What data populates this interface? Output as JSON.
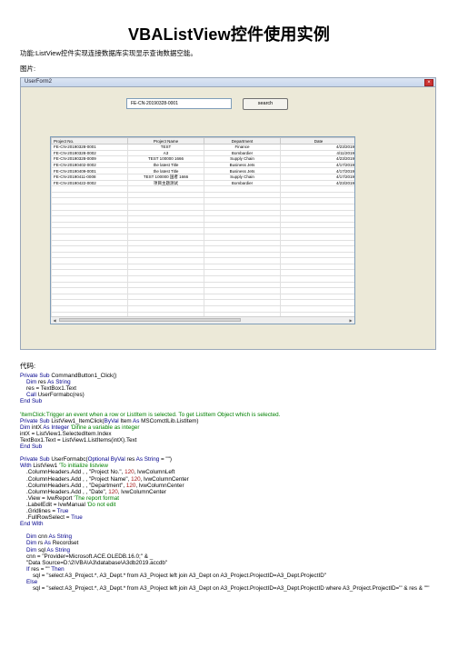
{
  "page": {
    "title": "VBAListView控件使用实例",
    "intro": "功能:ListView控件实现连接数据库实现显示查询数据空能。",
    "image_label": "图片:",
    "code_label": "代码:"
  },
  "form": {
    "title": "UserForm2",
    "textbox_value": "FE-CN-20190328-0001",
    "search_label": "search",
    "columns": [
      "Project No.",
      "Project Name",
      "Department",
      "Date"
    ],
    "rows": [
      [
        "FE-CN-20190328-0001",
        "TEST",
        "Finance",
        "4/23/2019"
      ],
      [
        "FE-CN-20190328-0002",
        "A3",
        "Bombardier",
        "4/11/2019"
      ],
      [
        "FE-CN-20190328-0009",
        "TEST 100000 1666",
        "Supply Chain",
        "4/23/2019"
      ],
      [
        "FE-CN-20190402-0002",
        "the latest Title",
        "Business Jets",
        "4/17/2019"
      ],
      [
        "FE-CN-20190409-0001",
        "the latest Title",
        "Business Jets",
        "4/17/2019"
      ],
      [
        "FE-CN-20190411-0008",
        "TEST 100000 国者 1666",
        "Supply Chain",
        "4/17/2019"
      ],
      [
        "FE-CN-20190422-0002",
        "项目主题测试",
        "Bombardier",
        "4/23/2019"
      ]
    ]
  },
  "code": [
    [
      {
        "t": "Private Sub ",
        "c": "kw"
      },
      {
        "t": "CommandButton1_Click()",
        "c": ""
      }
    ],
    [
      {
        "t": "    Dim ",
        "c": "kw"
      },
      {
        "t": "res ",
        "c": ""
      },
      {
        "t": "As String",
        "c": "kw"
      }
    ],
    [
      {
        "t": "    res = TextBox1.Text",
        "c": ""
      }
    ],
    [
      {
        "t": "    Call ",
        "c": "kw"
      },
      {
        "t": "UserFormabc(res)",
        "c": ""
      }
    ],
    [
      {
        "t": "End Sub",
        "c": "kw"
      }
    ],
    [
      {
        "t": "",
        "c": ""
      }
    ],
    [
      {
        "t": "'ItemClick:Trigger an event when a row or ListItem is selected. To get ListItem Object which is selected.",
        "c": "cm"
      }
    ],
    [
      {
        "t": "Private Sub ",
        "c": "kw"
      },
      {
        "t": "ListView1_ItemClick(",
        "c": ""
      },
      {
        "t": "ByVal ",
        "c": "kw"
      },
      {
        "t": "Item ",
        "c": ""
      },
      {
        "t": "As ",
        "c": "kw"
      },
      {
        "t": "MSComctlLib.ListItem)",
        "c": ""
      }
    ],
    [
      {
        "t": "Dim ",
        "c": "kw"
      },
      {
        "t": "intX ",
        "c": ""
      },
      {
        "t": "As Integer ",
        "c": "kw"
      },
      {
        "t": "'Difine a variable as integer",
        "c": "cm"
      }
    ],
    [
      {
        "t": "intX = ListView1.SelectedItem.Index",
        "c": ""
      }
    ],
    [
      {
        "t": "TextBox1.Text = ListView1.ListItems(intX).Text",
        "c": ""
      }
    ],
    [
      {
        "t": "End Sub",
        "c": "kw"
      }
    ],
    [
      {
        "t": "",
        "c": ""
      }
    ],
    [
      {
        "t": "Private Sub ",
        "c": "kw"
      },
      {
        "t": "UserFormabc(",
        "c": ""
      },
      {
        "t": "Optional ByVal ",
        "c": "kw"
      },
      {
        "t": "res ",
        "c": ""
      },
      {
        "t": "As String ",
        "c": "kw"
      },
      {
        "t": "= \"\")",
        "c": ""
      }
    ],
    [
      {
        "t": "With ",
        "c": "kw"
      },
      {
        "t": "ListView1 ",
        "c": ""
      },
      {
        "t": "'To initialize listview",
        "c": "cm"
      }
    ],
    [
      {
        "t": "    .ColumnHeaders.Add , , \"Project No.\", ",
        "c": ""
      },
      {
        "t": "120",
        "c": "nm"
      },
      {
        "t": ", lvwColumnLeft",
        "c": ""
      }
    ],
    [
      {
        "t": "    .ColumnHeaders.Add , , \"Project Name\", ",
        "c": ""
      },
      {
        "t": "120",
        "c": "nm"
      },
      {
        "t": ", lvwColumnCenter",
        "c": ""
      }
    ],
    [
      {
        "t": "    .ColumnHeaders.Add , , \"Department\", ",
        "c": ""
      },
      {
        "t": "120",
        "c": "nm"
      },
      {
        "t": ", lvwColumnCenter",
        "c": ""
      }
    ],
    [
      {
        "t": "    .ColumnHeaders.Add , , \"Date\", ",
        "c": ""
      },
      {
        "t": "120",
        "c": "nm"
      },
      {
        "t": ", lvwColumnCenter",
        "c": ""
      }
    ],
    [
      {
        "t": "    .View = lvwReport ",
        "c": ""
      },
      {
        "t": "'The report format",
        "c": "cm"
      }
    ],
    [
      {
        "t": "    .LabelEdit = lvwManual ",
        "c": ""
      },
      {
        "t": "'Do not edit",
        "c": "cm"
      }
    ],
    [
      {
        "t": "    .Gridlines = ",
        "c": ""
      },
      {
        "t": "True",
        "c": "kw"
      }
    ],
    [
      {
        "t": "    .FullRowSelect = ",
        "c": ""
      },
      {
        "t": "True",
        "c": "kw"
      }
    ],
    [
      {
        "t": "End With",
        "c": "kw"
      }
    ],
    [
      {
        "t": "",
        "c": ""
      }
    ],
    [
      {
        "t": "    Dim ",
        "c": "kw"
      },
      {
        "t": "cnn ",
        "c": ""
      },
      {
        "t": "As String",
        "c": "kw"
      }
    ],
    [
      {
        "t": "    Dim ",
        "c": "kw"
      },
      {
        "t": "rs ",
        "c": ""
      },
      {
        "t": "As ",
        "c": "kw"
      },
      {
        "t": "Recordset",
        "c": ""
      }
    ],
    [
      {
        "t": "    Dim ",
        "c": "kw"
      },
      {
        "t": "sql ",
        "c": ""
      },
      {
        "t": "As String",
        "c": "kw"
      }
    ],
    [
      {
        "t": "    cnn = \"Provider=Microsoft.ACE.OLEDB.16.0;\" & _",
        "c": ""
      }
    ],
    [
      {
        "t": "    \"Data Source=D:\\2\\VBA\\A3\\database\\A3db2019.accdb\"",
        "c": ""
      }
    ],
    [
      {
        "t": "    If ",
        "c": "kw"
      },
      {
        "t": "res = \"\" ",
        "c": ""
      },
      {
        "t": "Then",
        "c": "kw"
      }
    ],
    [
      {
        "t": "        sql = \"select A3_Project.*, A3_Dept.* from A3_Project left join A3_Dept on A3_Project.ProjectID=A3_Dept.ProjectID\"",
        "c": ""
      }
    ],
    [
      {
        "t": "    Else",
        "c": "kw"
      }
    ],
    [
      {
        "t": "        sql = \"select A3_Project.*, A3_Dept.* from A3_Project left join A3_Dept on A3_Project.ProjectID=A3_Dept.ProjectID where A3_Project.ProjectID='\" & res & \"'\"",
        "c": ""
      }
    ]
  ]
}
